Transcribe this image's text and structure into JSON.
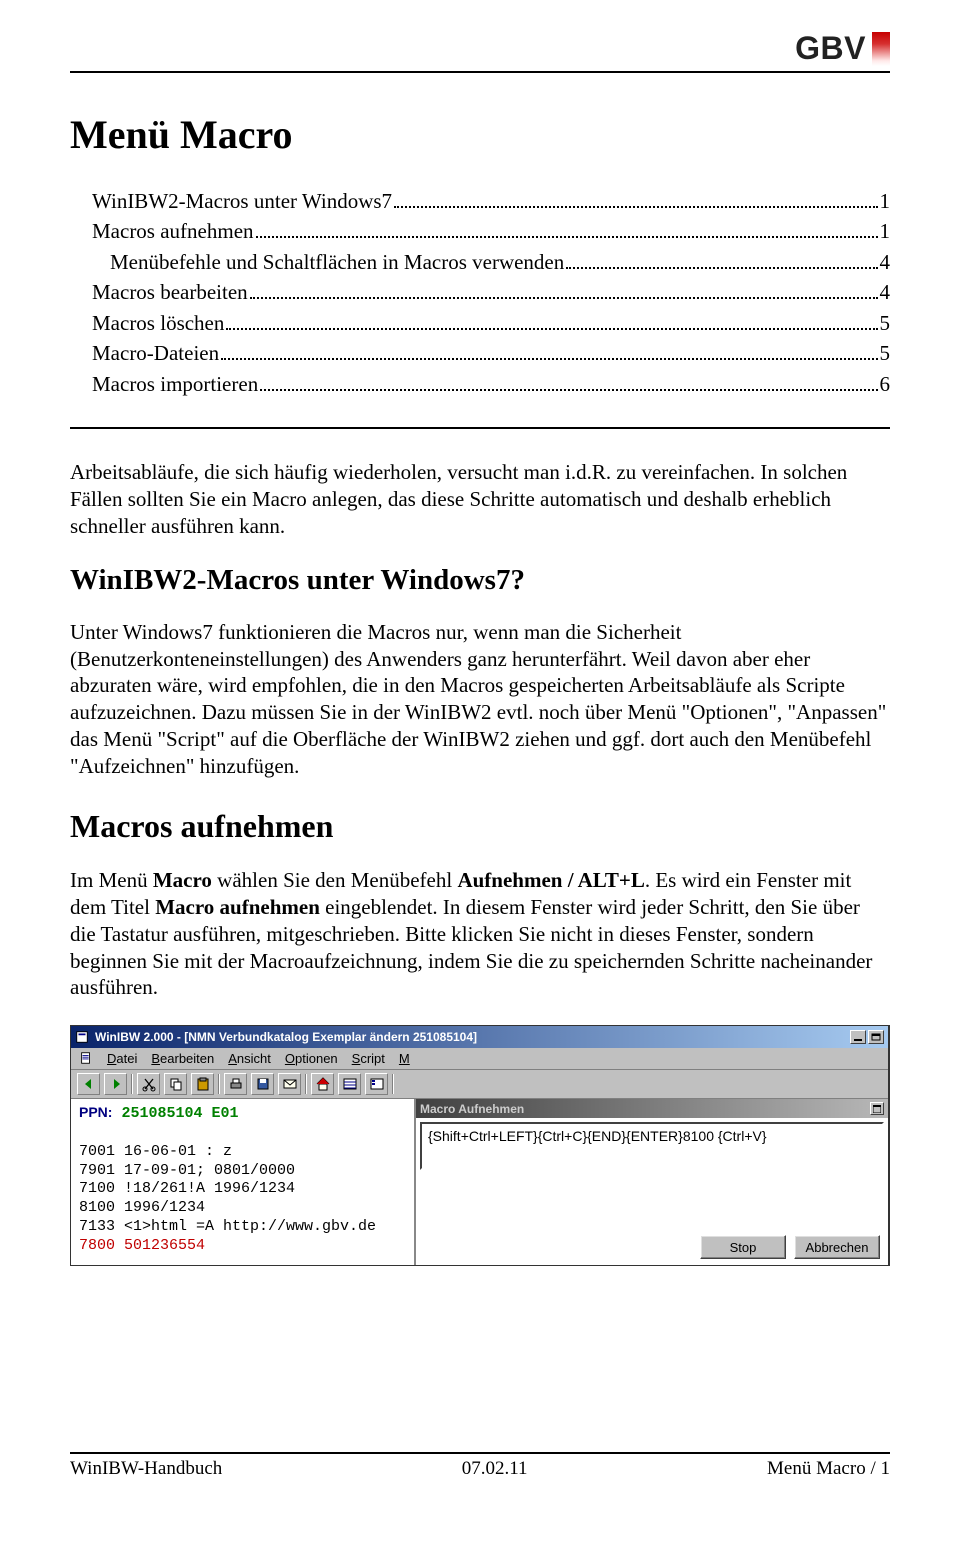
{
  "brand": "GBV",
  "page_title": "Menü Macro",
  "toc": [
    {
      "label": "WinIBW2-Macros unter Windows7",
      "page": "1",
      "indent": false
    },
    {
      "label": "Macros aufnehmen",
      "page": "1",
      "indent": false
    },
    {
      "label": "Menübefehle und Schaltflächen in Macros verwenden",
      "page": "4",
      "indent": true
    },
    {
      "label": "Macros bearbeiten",
      "page": "4",
      "indent": false
    },
    {
      "label": "Macros löschen",
      "page": "5",
      "indent": false
    },
    {
      "label": "Macro-Dateien",
      "page": "5",
      "indent": false
    },
    {
      "label": "Macros importieren",
      "page": "6",
      "indent": false
    }
  ],
  "intro_para": "Arbeitsabläufe, die sich häufig wiederholen, versucht man i.d.R. zu vereinfachen. In solchen Fällen sollten Sie ein Macro anlegen, das diese Schritte automatisch und deshalb erheblich schneller ausführen kann.",
  "section1_title": "WinIBW2-Macros unter Windows7?",
  "section1_para": "Unter Windows7 funktionieren die Macros nur, wenn man die Sicherheit (Benutzerkonteneinstellungen) des Anwenders ganz herunterfährt. Weil davon aber eher abzuraten wäre, wird empfohlen, die in den Macros gespeicherten Arbeitsabläufe als Scripte aufzuzeichnen. Dazu müssen Sie in der WinIBW2 evtl. noch über Menü \"Optionen\", \"Anpassen\" das Menü \"Script\" auf die Oberfläche der WinIBW2 ziehen und ggf. dort auch den Menübefehl \"Aufzeichnen\" hinzufügen.",
  "section2_title": "Macros aufnehmen",
  "section2_para_html": "Im Menü <b>Macro</b> wählen Sie den Menübefehl <b>Aufnehmen / ALT+L</b>. Es wird ein Fenster mit dem Titel <b>Macro aufnehmen</b> eingeblendet. In diesem Fenster wird jeder Schritt, den Sie über die Tastatur ausführen, mitgeschrieben. Bitte klicken Sie nicht in dieses Fenster, sondern beginnen Sie mit der Macroaufzeichnung, indem Sie die zu speichernden Schritte nacheinander ausführen.",
  "screenshot": {
    "app_title": "WinIBW 2.000 - [NMN Verbundkatalog Exemplar ändern 251085104]",
    "menus": [
      "Datei",
      "Bearbeiten",
      "Ansicht",
      "Optionen",
      "Script",
      "M"
    ],
    "float_title": "Macro Aufnehmen",
    "macro_keys": "{Shift+Ctrl+LEFT}{Ctrl+C}{END}{ENTER}8100 {Ctrl+V}",
    "ppn_label": "PPN:",
    "ppn_value": "251085104 E01",
    "lines": [
      "7001 16-06-01 : z",
      "7901 17-09-01; 0801/0000",
      "7100 !18/261!A 1996/1234",
      "8100 1996/1234",
      "7133 <1>html =A http://www.gbv.de"
    ],
    "line_red": "7800 501236554",
    "btn_stop": "Stop",
    "btn_cancel": "Abbrechen"
  },
  "footer": {
    "left": "WinIBW-Handbuch",
    "center": "07.02.11",
    "right": "Menü Macro / 1"
  }
}
